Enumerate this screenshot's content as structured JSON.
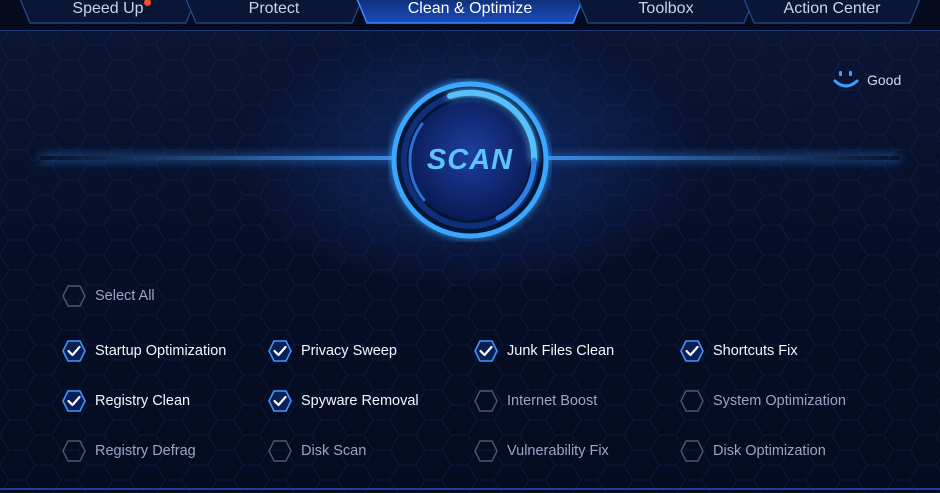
{
  "tabs": [
    {
      "label": "Speed Up",
      "active": false,
      "notify": true
    },
    {
      "label": "Protect",
      "active": false,
      "notify": false
    },
    {
      "label": "Clean & Optimize",
      "active": true,
      "notify": false
    },
    {
      "label": "Toolbox",
      "active": false,
      "notify": false
    },
    {
      "label": "Action Center",
      "active": false,
      "notify": false
    }
  ],
  "status": {
    "icon": "smiley-icon",
    "label": "Good"
  },
  "scan": {
    "label": "SCAN"
  },
  "select_all": {
    "label": "Select All",
    "checked": false
  },
  "options": [
    {
      "label": "Startup Optimization",
      "checked": true
    },
    {
      "label": "Privacy Sweep",
      "checked": true
    },
    {
      "label": "Junk Files Clean",
      "checked": true
    },
    {
      "label": "Shortcuts Fix",
      "checked": true
    },
    {
      "label": "Registry Clean",
      "checked": true
    },
    {
      "label": "Spyware Removal",
      "checked": true
    },
    {
      "label": "Internet Boost",
      "checked": false
    },
    {
      "label": "System Optimization",
      "checked": false
    },
    {
      "label": "Registry Defrag",
      "checked": false
    },
    {
      "label": "Disk Scan",
      "checked": false
    },
    {
      "label": "Vulnerability Fix",
      "checked": false
    },
    {
      "label": "Disk Optimization",
      "checked": false
    }
  ],
  "colors": {
    "accent": "#2f8bff",
    "background": "#07102a",
    "notify_dot": "#ff4a24",
    "checked_border": "#3e97ff"
  }
}
